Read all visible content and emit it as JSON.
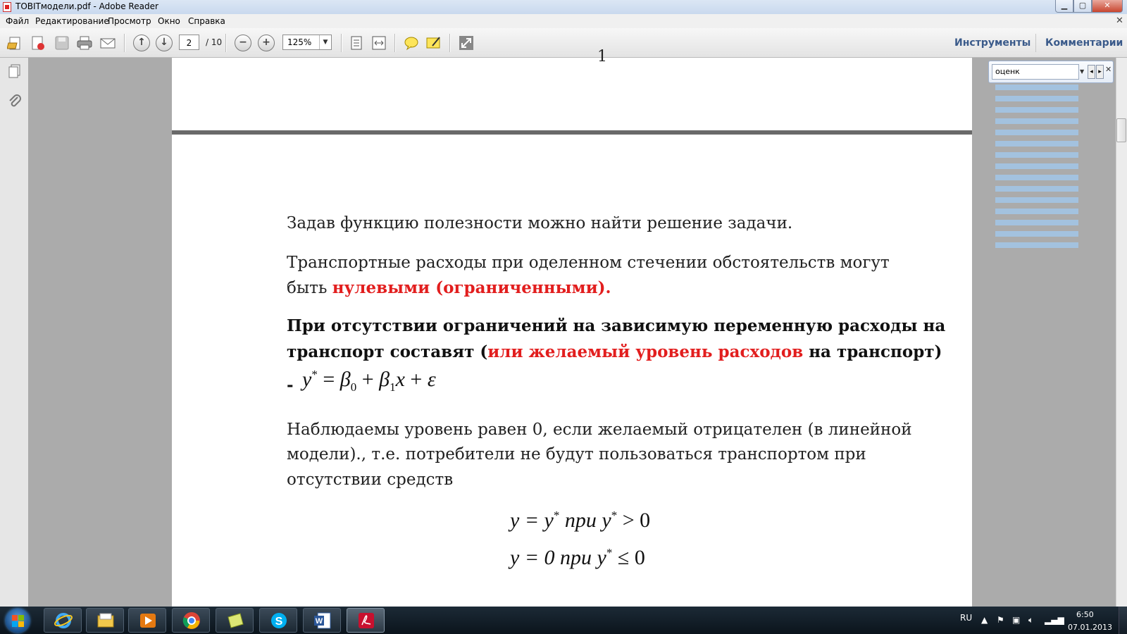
{
  "window": {
    "title": "TOBITмодели.pdf - Adobe Reader"
  },
  "menu": [
    "Файл",
    "Редактирование",
    "Просмотр",
    "Окно",
    "Справка"
  ],
  "toolbar": {
    "page_current": "2",
    "page_total": "/ 10",
    "zoom": "125%",
    "tools": "Инструменты",
    "comments": "Комментарии"
  },
  "search": {
    "query": "оценк"
  },
  "document": {
    "page_top_fragment": "1",
    "p1": "Задав функцию полезности можно найти решение задачи.",
    "p2_line1": "Транспортные расходы при оделенном стечении обстоятельств могут",
    "p2_line2_prefix": "быть ",
    "p2_line2_red": "нулевыми (ограниченными).",
    "p3_line1": "При отсутствии ограничений на зависимую переменную расходы на",
    "p3_line2_prefix": "транспорт составят  (",
    "p3_line2_red": "или желаемый уровень расходов",
    "p3_line2_suffix": " на транспорт)",
    "p3_bullet": "-",
    "eq1": {
      "lhs": "y",
      "star": "*",
      "eq": " = ",
      "b0": "β",
      "s0": "0",
      "plus1": " + ",
      "b1": "β",
      "s1": "1",
      "x": "x",
      "plus2": " + ",
      "eps": "ε"
    },
    "p4_line1": "Наблюдаемы уровень равен 0, если желаемый отрицателен (в линейной",
    "p4_line2": "модели)., т.е. потребители не будут пользоваться транспортом при",
    "p4_line3": "отсутствии средств",
    "eq2": {
      "a": "y = y",
      "star": "*",
      "mid": "  при    y",
      "star2": "*",
      "end": " > 0"
    },
    "eq3": {
      "a": "y = 0   при    y",
      "star": "*",
      "end": " ≤ 0"
    }
  },
  "taskbar": {
    "lang": "RU",
    "time": "6:50",
    "date": "07.01.2013"
  },
  "colors": {
    "accent_red": "#e21e1e",
    "link_blue": "#3a5a8a",
    "search_hit": "#a3c2df"
  }
}
